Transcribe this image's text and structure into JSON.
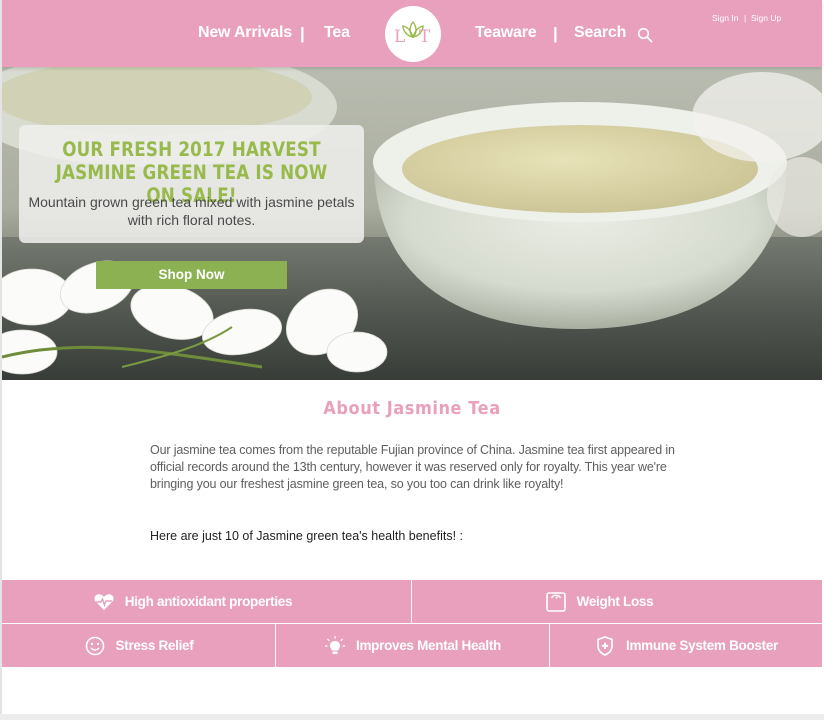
{
  "header": {
    "nav": {
      "new_arrivals": "New Arrivals",
      "tea": "Tea",
      "teaware": "Teaware",
      "search": "Search",
      "separator": "|"
    },
    "logo_text": "LT",
    "auth": {
      "sign_in": "Sign In",
      "separator": "|",
      "sign_up": "Sign Up"
    }
  },
  "hero": {
    "title": "Our fresh 2017 harvest jasmine green tea is now on sale!",
    "subtitle": "Mountain grown green tea mixed with jasmine petals with rich floral notes.",
    "cta_label": "Shop Now"
  },
  "about": {
    "title": "About Jasmine Tea",
    "body": "Our jasmine tea comes from the reputable Fujian province of China. Jasmine tea first appeared in official records around the 13th century, however it was reserved only for royalty. This year we're bringing you our freshest jasmine green tea, so you too can drink like royalty!",
    "benefits_intro": "Here are just 10 of Jasmine green tea's health benefits! :"
  },
  "benefits": [
    {
      "label": "High antioxidant properties",
      "icon": "heart-pulse-icon"
    },
    {
      "label": "Weight Loss",
      "icon": "scale-icon"
    },
    {
      "label": "Stress Relief",
      "icon": "smiley-icon"
    },
    {
      "label": "Improves Mental Health",
      "icon": "lightbulb-icon"
    },
    {
      "label": "Immune System Booster",
      "icon": "shield-plus-icon"
    }
  ],
  "colors": {
    "header_pink": "#e8a0bd",
    "accent_green": "#98ba4c",
    "button_green": "#8cb153",
    "text_gray": "#5e5e5e"
  }
}
